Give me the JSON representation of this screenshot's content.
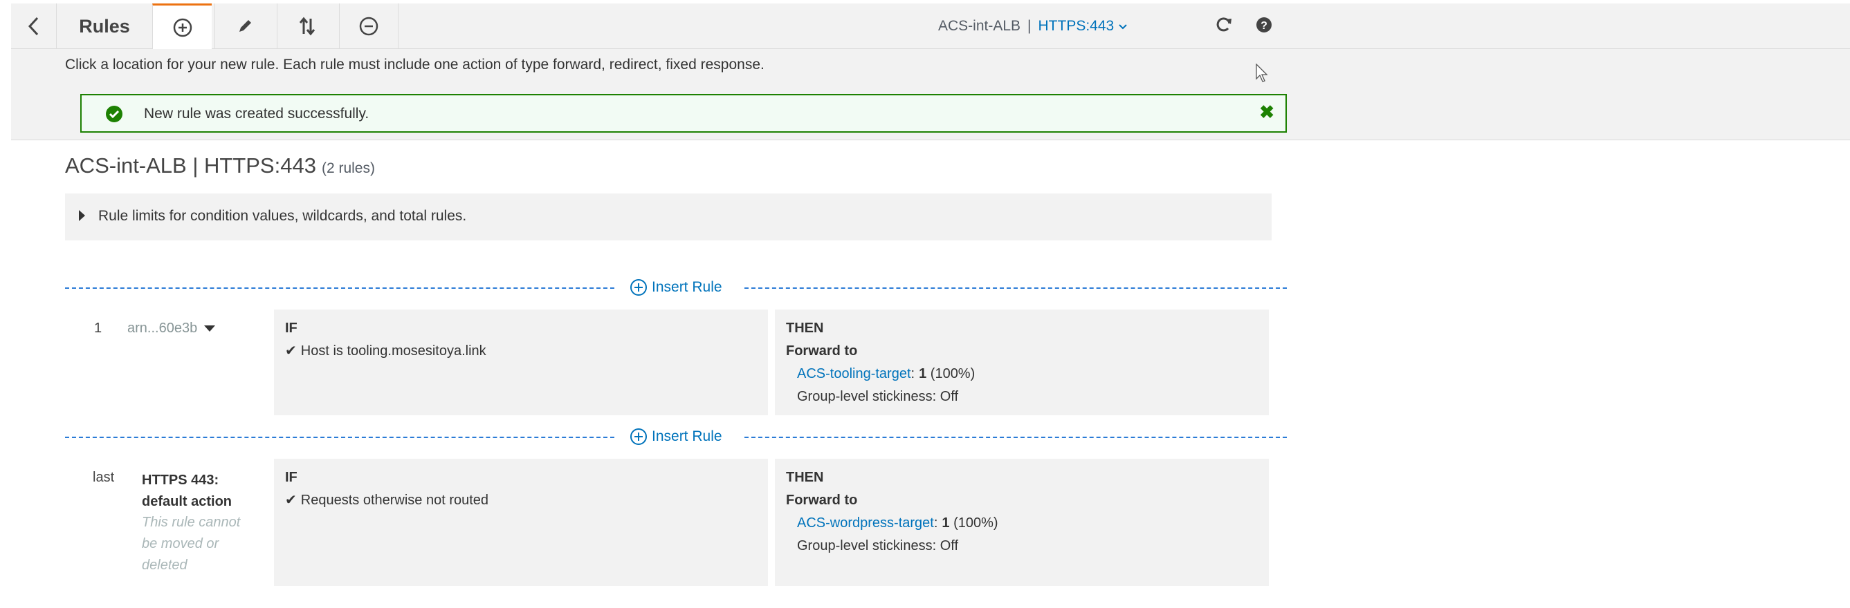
{
  "toolbar": {
    "back_label": "Back",
    "title": "Rules",
    "tools": [
      {
        "icon": "plus-circle-icon",
        "active": true
      },
      {
        "icon": "pencil-icon",
        "active": false
      },
      {
        "icon": "reorder-arrows-icon",
        "active": false
      },
      {
        "icon": "minus-circle-icon",
        "active": false
      }
    ],
    "lb_name": "ACS-int-ALB",
    "separator": "|",
    "listener": "HTTPS:443",
    "refresh_icon": "refresh-icon",
    "help_icon": "help-icon"
  },
  "banner": {
    "instruction": "Click a location for your new rule. Each rule must include one action of type forward, redirect, fixed response.",
    "success_message": "New rule was created successfully.",
    "success_icon": "check-circle-icon",
    "close_icon": "close-icon"
  },
  "heading": {
    "title": "ACS-int-ALB | HTTPS:443",
    "count": "(2 rules)"
  },
  "limits": {
    "label": "Rule limits for condition values, wildcards, and total rules."
  },
  "insert_label": "Insert Rule",
  "rules": [
    {
      "number": "1",
      "arn": "arn...60e3b",
      "if_label": "IF",
      "condition_prefix": "Host is",
      "condition_value": "tooling.mosesitoya.link",
      "then_label": "THEN",
      "action": "Forward to",
      "target": "ACS-tooling-target",
      "weight": "1",
      "percent": "(100%)",
      "stickiness": "Group-level stickiness: Off"
    },
    {
      "number": "last",
      "label": "HTTPS 443: default action",
      "note": "This rule cannot be moved or deleted",
      "if_label": "IF",
      "condition": "Requests otherwise not routed",
      "then_label": "THEN",
      "action": "Forward to",
      "target": "ACS-wordpress-target",
      "weight": "1",
      "percent": "(100%)",
      "stickiness": "Group-level stickiness: Off"
    }
  ],
  "colors": {
    "accent": "#ec7211",
    "link": "#0073bb",
    "success": "#1d8102"
  }
}
